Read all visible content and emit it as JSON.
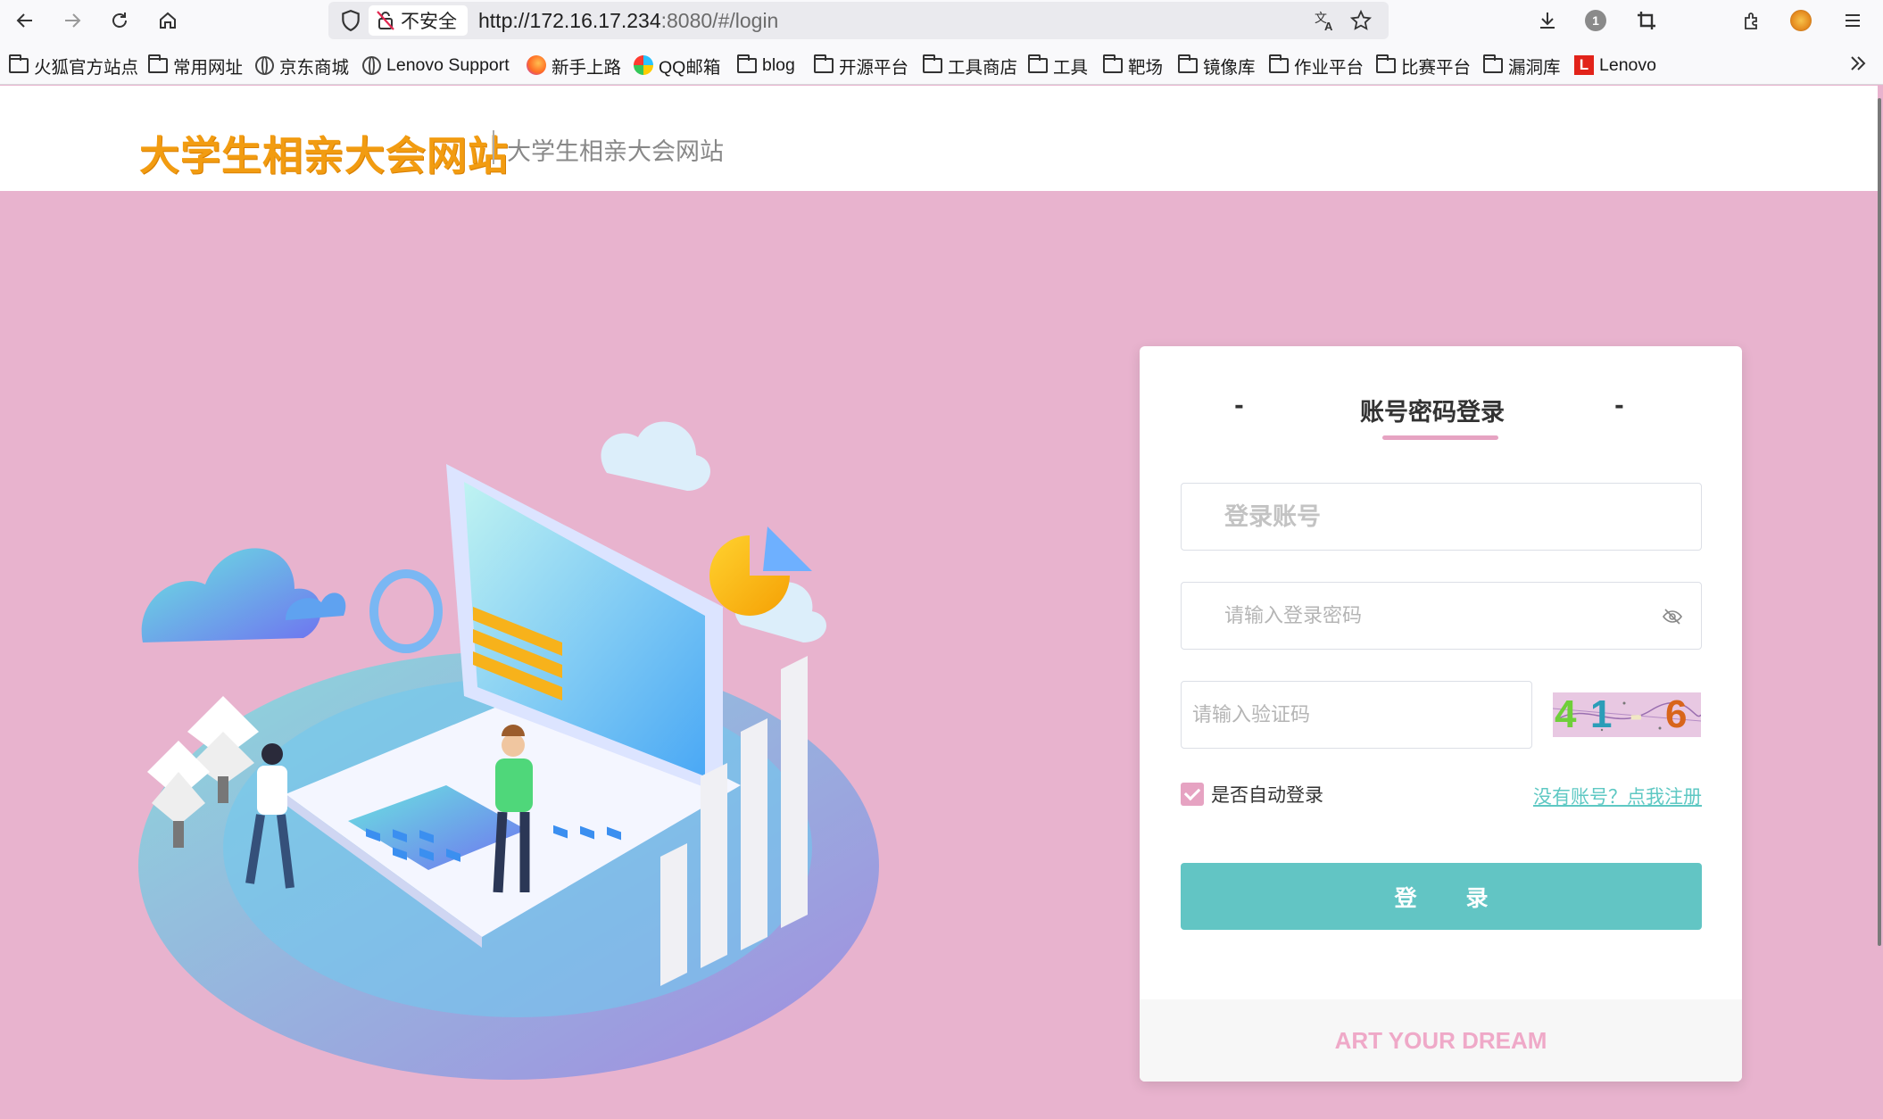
{
  "browser": {
    "insecure_label": "不安全",
    "url_host": "http://172.16.17.234",
    "url_rest": ":8080/#/login",
    "badge_count": "1"
  },
  "bookmarks": [
    {
      "label": "火狐官方站点",
      "icon": "folder"
    },
    {
      "label": "常用网址",
      "icon": "folder"
    },
    {
      "label": "京东商城",
      "icon": "globe"
    },
    {
      "label": "Lenovo Support",
      "icon": "globe"
    },
    {
      "label": "新手上路",
      "icon": "firefox"
    },
    {
      "label": "QQ邮箱",
      "icon": "qq"
    },
    {
      "label": "blog",
      "icon": "folder"
    },
    {
      "label": "开源平台",
      "icon": "folder"
    },
    {
      "label": "工具商店",
      "icon": "folder"
    },
    {
      "label": "工具",
      "icon": "folder"
    },
    {
      "label": "靶场",
      "icon": "folder"
    },
    {
      "label": "镜像库",
      "icon": "folder"
    },
    {
      "label": "作业平台",
      "icon": "folder"
    },
    {
      "label": "比赛平台",
      "icon": "folder"
    },
    {
      "label": "漏洞库",
      "icon": "folder"
    },
    {
      "label": "Lenovo",
      "icon": "lenovo"
    }
  ],
  "site": {
    "logo": "大学生相亲大会网站",
    "subtitle": "大学生相亲大会网站"
  },
  "login": {
    "tab_left": "-",
    "tab_title": "账号密码登录",
    "tab_right": "-",
    "account_placeholder": "登录账号",
    "password_placeholder": "请输入登录密码",
    "captcha_placeholder": "请输入验证码",
    "captcha_chars": [
      "4",
      "1",
      "-",
      "6"
    ],
    "remember_label": "是否自动登录",
    "register_link": "没有账号？点我注册",
    "login_button": "登 录",
    "footer": "ART YOUR DREAM"
  },
  "colors": {
    "page_bg": "#e8b3ce",
    "accent_pink": "#e6a3c2",
    "button_teal": "#62c5c4",
    "logo_orange": "#f29c11"
  }
}
